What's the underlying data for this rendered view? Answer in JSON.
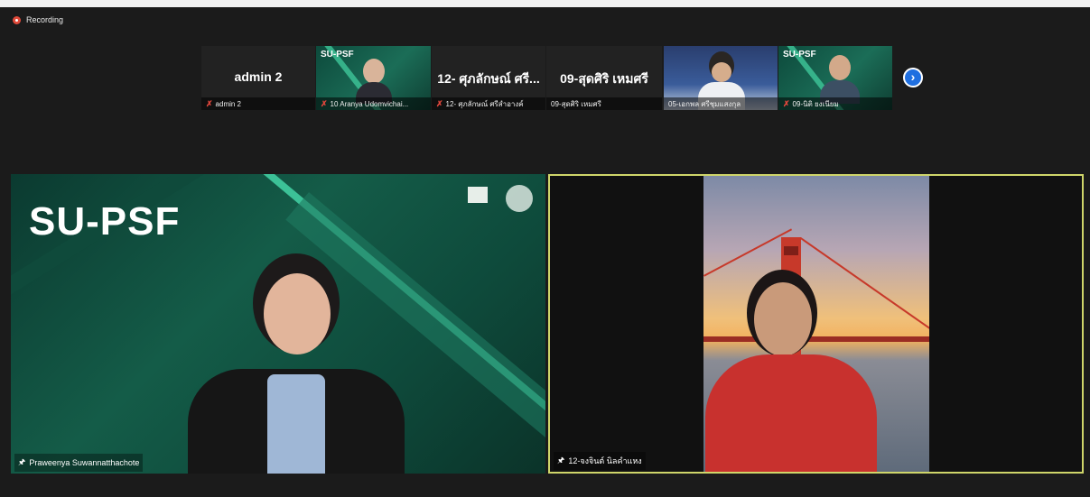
{
  "recording": {
    "label": "Recording"
  },
  "thumbnails": [
    {
      "name": "admin 2",
      "big_label": "admin 2",
      "muted": true
    },
    {
      "name": "10 Aranya Udomvichai...",
      "brand": "SU-PSF",
      "muted": true
    },
    {
      "name": "12- ศุภลักษณ์ ศรีสำอางค์",
      "big_label": "12- ศุภลักษณ์ ศรี...",
      "muted": true
    },
    {
      "name": "09-สุดศิริ เหมศรี",
      "big_label": "09-สุดศิริ เหมศรี",
      "muted": false
    },
    {
      "name": "05-เอกพล ศรีชุมแสงกุล",
      "muted": false
    },
    {
      "name": "09-นิติ ยงเนียม",
      "brand": "SU-PSF",
      "muted": true
    }
  ],
  "next_button": {
    "icon": "chevron-right-icon"
  },
  "main_tiles": [
    {
      "name": "Praweenya Suwannatthachote",
      "brand": "SU-PSF",
      "pinned": true
    },
    {
      "name": "12-จงจินต์ นิลคำแหง",
      "pinned": true,
      "active_speaker_color": "#cfd66a"
    }
  ],
  "colors": {
    "brand_green": "#145c48",
    "recording_red": "#e04a3a",
    "muted_red": "#e0463c",
    "next_blue": "#1f6fe0"
  }
}
